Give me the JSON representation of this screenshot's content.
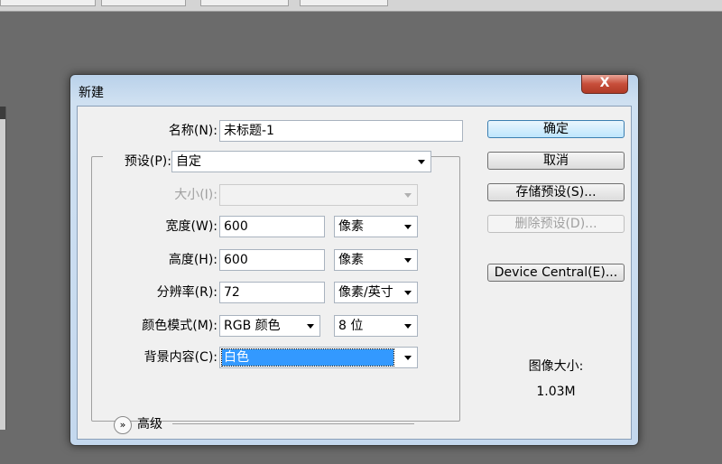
{
  "dialog": {
    "title": "新建",
    "close_label": "X"
  },
  "form": {
    "name_label": "名称(N):",
    "name_value": "未标题-1",
    "preset_label": "预设(P):",
    "preset_value": "自定",
    "size_label": "大小(I):",
    "size_value": "",
    "width_label": "宽度(W):",
    "width_value": "600",
    "width_unit": "像素",
    "height_label": "高度(H):",
    "height_value": "600",
    "height_unit": "像素",
    "resolution_label": "分辨率(R):",
    "resolution_value": "72",
    "resolution_unit": "像素/英寸",
    "color_mode_label": "颜色模式(M):",
    "color_mode_value": "RGB 颜色",
    "bit_depth_value": "8 位",
    "background_label": "背景内容(C):",
    "background_value": "白色",
    "advanced_label": "高级"
  },
  "buttons": {
    "ok": "确定",
    "cancel": "取消",
    "save_preset": "存储预设(S)...",
    "delete_preset": "删除预设(D)...",
    "device_central": "Device Central(E)..."
  },
  "image_size": {
    "label": "图像大小:",
    "value": "1.03M"
  },
  "colors": {
    "selection": "#3399ff",
    "dialog_frame": "#c4d8ee",
    "close_button": "#c74e3a"
  }
}
